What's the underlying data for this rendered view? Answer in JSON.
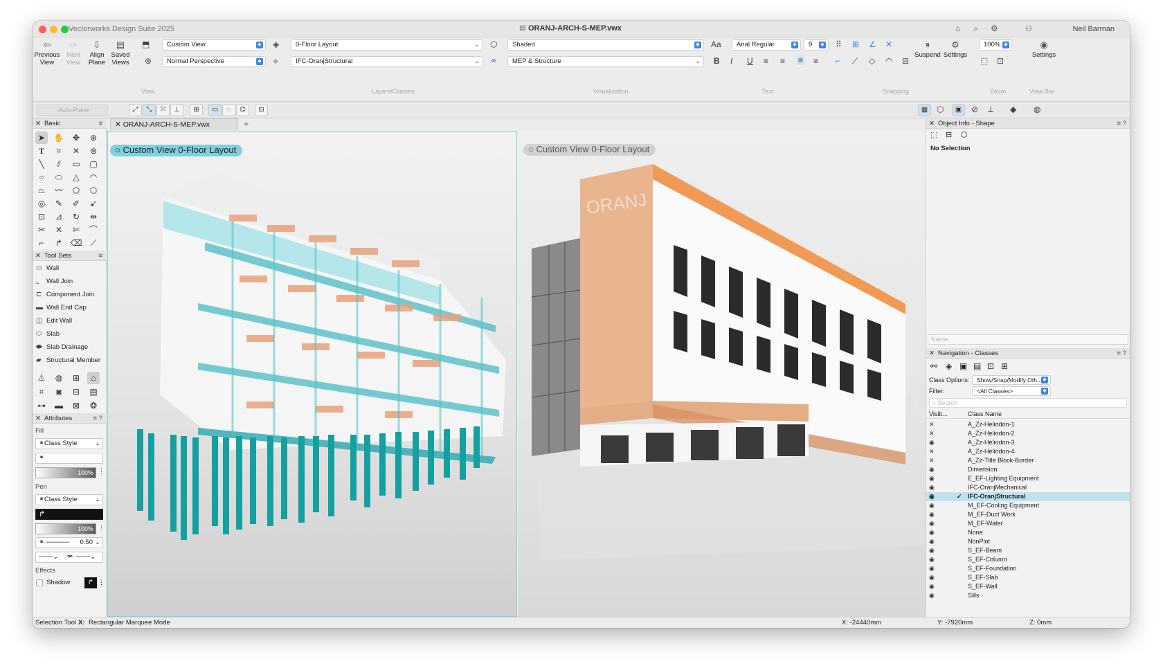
{
  "window": {
    "app_title": "Vectorworks Design Suite 2025",
    "doc_title": "ORANJ-ARCH-S-MEP.vwx",
    "user": "Neil Barman"
  },
  "toolbar": {
    "previous_view": "Previous View",
    "next_view": "Next View",
    "align_plane": "Align Plane",
    "saved_views": "Saved Views",
    "view_select": "Custom View",
    "projection_select": "Normal Perspective",
    "group_view": "View",
    "layer_select": "0-Floor Layout",
    "class_select": "IFC-OranjStructural",
    "group_layers": "Layers/Classes",
    "render_select": "Shaded",
    "config_select": "MEP & Structure",
    "group_visualization": "Visualization",
    "font_select": "Arial Regular",
    "font_size": "9",
    "group_text": "Text",
    "group_snapping": "Snapping",
    "suspend": "Suspend",
    "settings1": "Settings",
    "zoom_value": "100%",
    "group_zoom": "Zoom",
    "settings2": "Settings",
    "group_viewbar": "View Bar",
    "auto_plane": "Auto-Plane"
  },
  "palettes": {
    "basic": "Basic",
    "tool_sets": "Tool Sets",
    "tool_set_items": [
      "Wall",
      "Wall Join",
      "Component Join",
      "Wall End Cap",
      "Edit Wall",
      "Slab",
      "Slab Drainage",
      "Structural Member"
    ],
    "attributes": "Attributes",
    "fill_label": "Fill",
    "fill_style": "Class Style",
    "fill_opacity": "100%",
    "pen_label": "Pen",
    "pen_style": "Class Style",
    "pen_opacity": "100%",
    "line_weight": "0.50",
    "effects_label": "Effects",
    "shadow_label": "Shadow"
  },
  "viewports": {
    "tab": "ORANJ-ARCH-S-MEP.vwx",
    "left_label": "Custom View  0-Floor Layout",
    "right_label": "Custom View  0-Floor Layout",
    "sign_text": "ORANJ"
  },
  "object_info": {
    "title": "Object Info - Shape",
    "selection": "No Selection",
    "name_placeholder": "Name:"
  },
  "navigation": {
    "title": "Navigation - Classes",
    "class_options_label": "Class Options:",
    "class_options_value": "Show/Snap/Modify Oth...",
    "filter_label": "Filter:",
    "filter_value": "<All Classes>",
    "search_placeholder": "Search",
    "col_visibility": "Visib...",
    "col_class_name": "Class Name",
    "classes": [
      {
        "name": "A_Zz-Heliodon-1",
        "vis": "x"
      },
      {
        "name": "A_Zz-Heliodon-2",
        "vis": "x"
      },
      {
        "name": "A_Zz-Heliodon-3",
        "vis": "eye"
      },
      {
        "name": "A_Zz-Heliodon-4",
        "vis": "x"
      },
      {
        "name": "A_Zz-Title Block-Border",
        "vis": "x"
      },
      {
        "name": "Dimension",
        "vis": "eye"
      },
      {
        "name": "E_EF-Lighting Equipment",
        "vis": "eye"
      },
      {
        "name": "IFC-OranjMechanical",
        "vis": "eye"
      },
      {
        "name": "IFC-OranjStructural",
        "vis": "eye",
        "active": true
      },
      {
        "name": "M_EF-Cooling Equipment",
        "vis": "eye"
      },
      {
        "name": "M_EF-Duct Work",
        "vis": "eye"
      },
      {
        "name": "M_EF-Water",
        "vis": "eye"
      },
      {
        "name": "None",
        "vis": "eye"
      },
      {
        "name": "NonPlot",
        "vis": "eye"
      },
      {
        "name": "S_EF-Beam",
        "vis": "eye"
      },
      {
        "name": "S_EF-Column",
        "vis": "eye"
      },
      {
        "name": "S_EF-Foundation",
        "vis": "eye"
      },
      {
        "name": "S_EF-Slab",
        "vis": "eye"
      },
      {
        "name": "S_EF-Wall",
        "vis": "eye"
      },
      {
        "name": "Sills",
        "vis": "eye"
      }
    ]
  },
  "status": {
    "tool": "Selection Tool",
    "mode_key": "X:",
    "mode": "Rectangular Marquee Mode",
    "x": "X: -24440mm",
    "y": "Y: -7920mm",
    "z": "Z: 0mm"
  }
}
